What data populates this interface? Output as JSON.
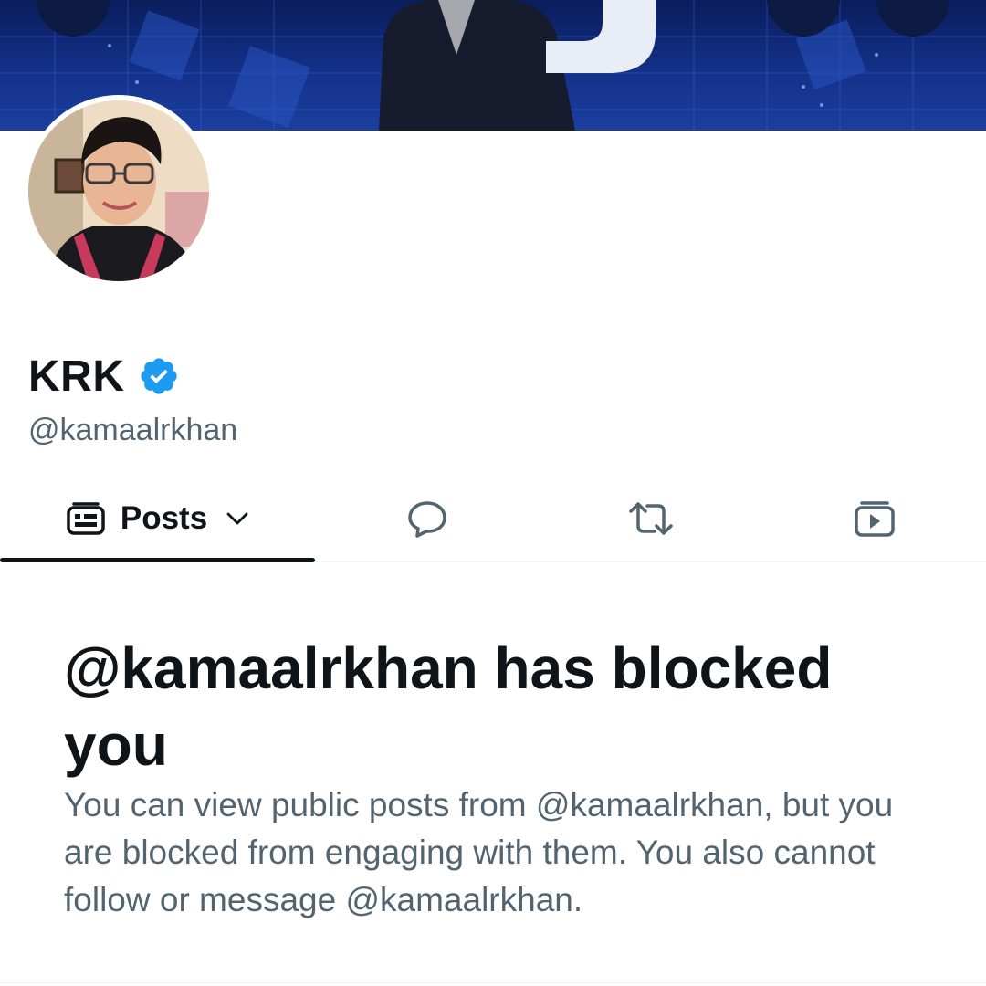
{
  "profile": {
    "display_name": "KRK",
    "handle": "@kamaalrkhan",
    "verified": true
  },
  "tabs": {
    "posts_label": "Posts"
  },
  "blocked": {
    "title": "@kamaalrkhan has blocked you",
    "description": "You can view public posts from @kamaalrkhan, but you are blocked from engaging with them. You also cannot follow or message @kamaalrkhan."
  },
  "icons": {
    "verified": "verified-badge-icon",
    "posts": "posts-icon",
    "dropdown": "chevron-down-icon",
    "replies": "reply-icon",
    "reposts": "repost-icon",
    "media": "media-icon"
  },
  "colors": {
    "verified_blue": "#1d9bf0",
    "text_primary": "#0f1419",
    "text_secondary": "#536471",
    "banner_blue": "#14318a"
  }
}
